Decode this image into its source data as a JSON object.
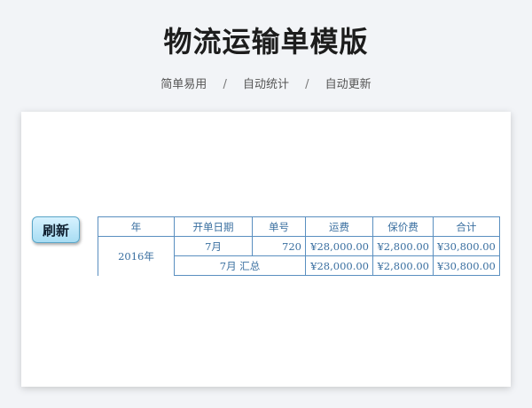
{
  "header": {
    "title": "物流运输单模版",
    "tags": [
      "简单易用",
      "自动统计",
      "自动更新"
    ],
    "separator": "/"
  },
  "sheet": {
    "refresh_label": "刷新",
    "columns": [
      "年",
      "开单日期",
      "单号",
      "运费",
      "保价费",
      "合计"
    ],
    "year": "2016年",
    "rows": [
      {
        "month": "7月",
        "order_no": "720",
        "freight": "¥28,000.00",
        "insurance": "¥2,800.00",
        "total": "¥30,800.00"
      }
    ],
    "subtotal": {
      "label": "7月 汇总",
      "freight": "¥28,000.00",
      "insurance": "¥2,800.00",
      "total": "¥30,800.00"
    }
  },
  "colors": {
    "border": "#5a8fc0",
    "text": "#3a6fa0",
    "button": "#a8ddf3"
  }
}
